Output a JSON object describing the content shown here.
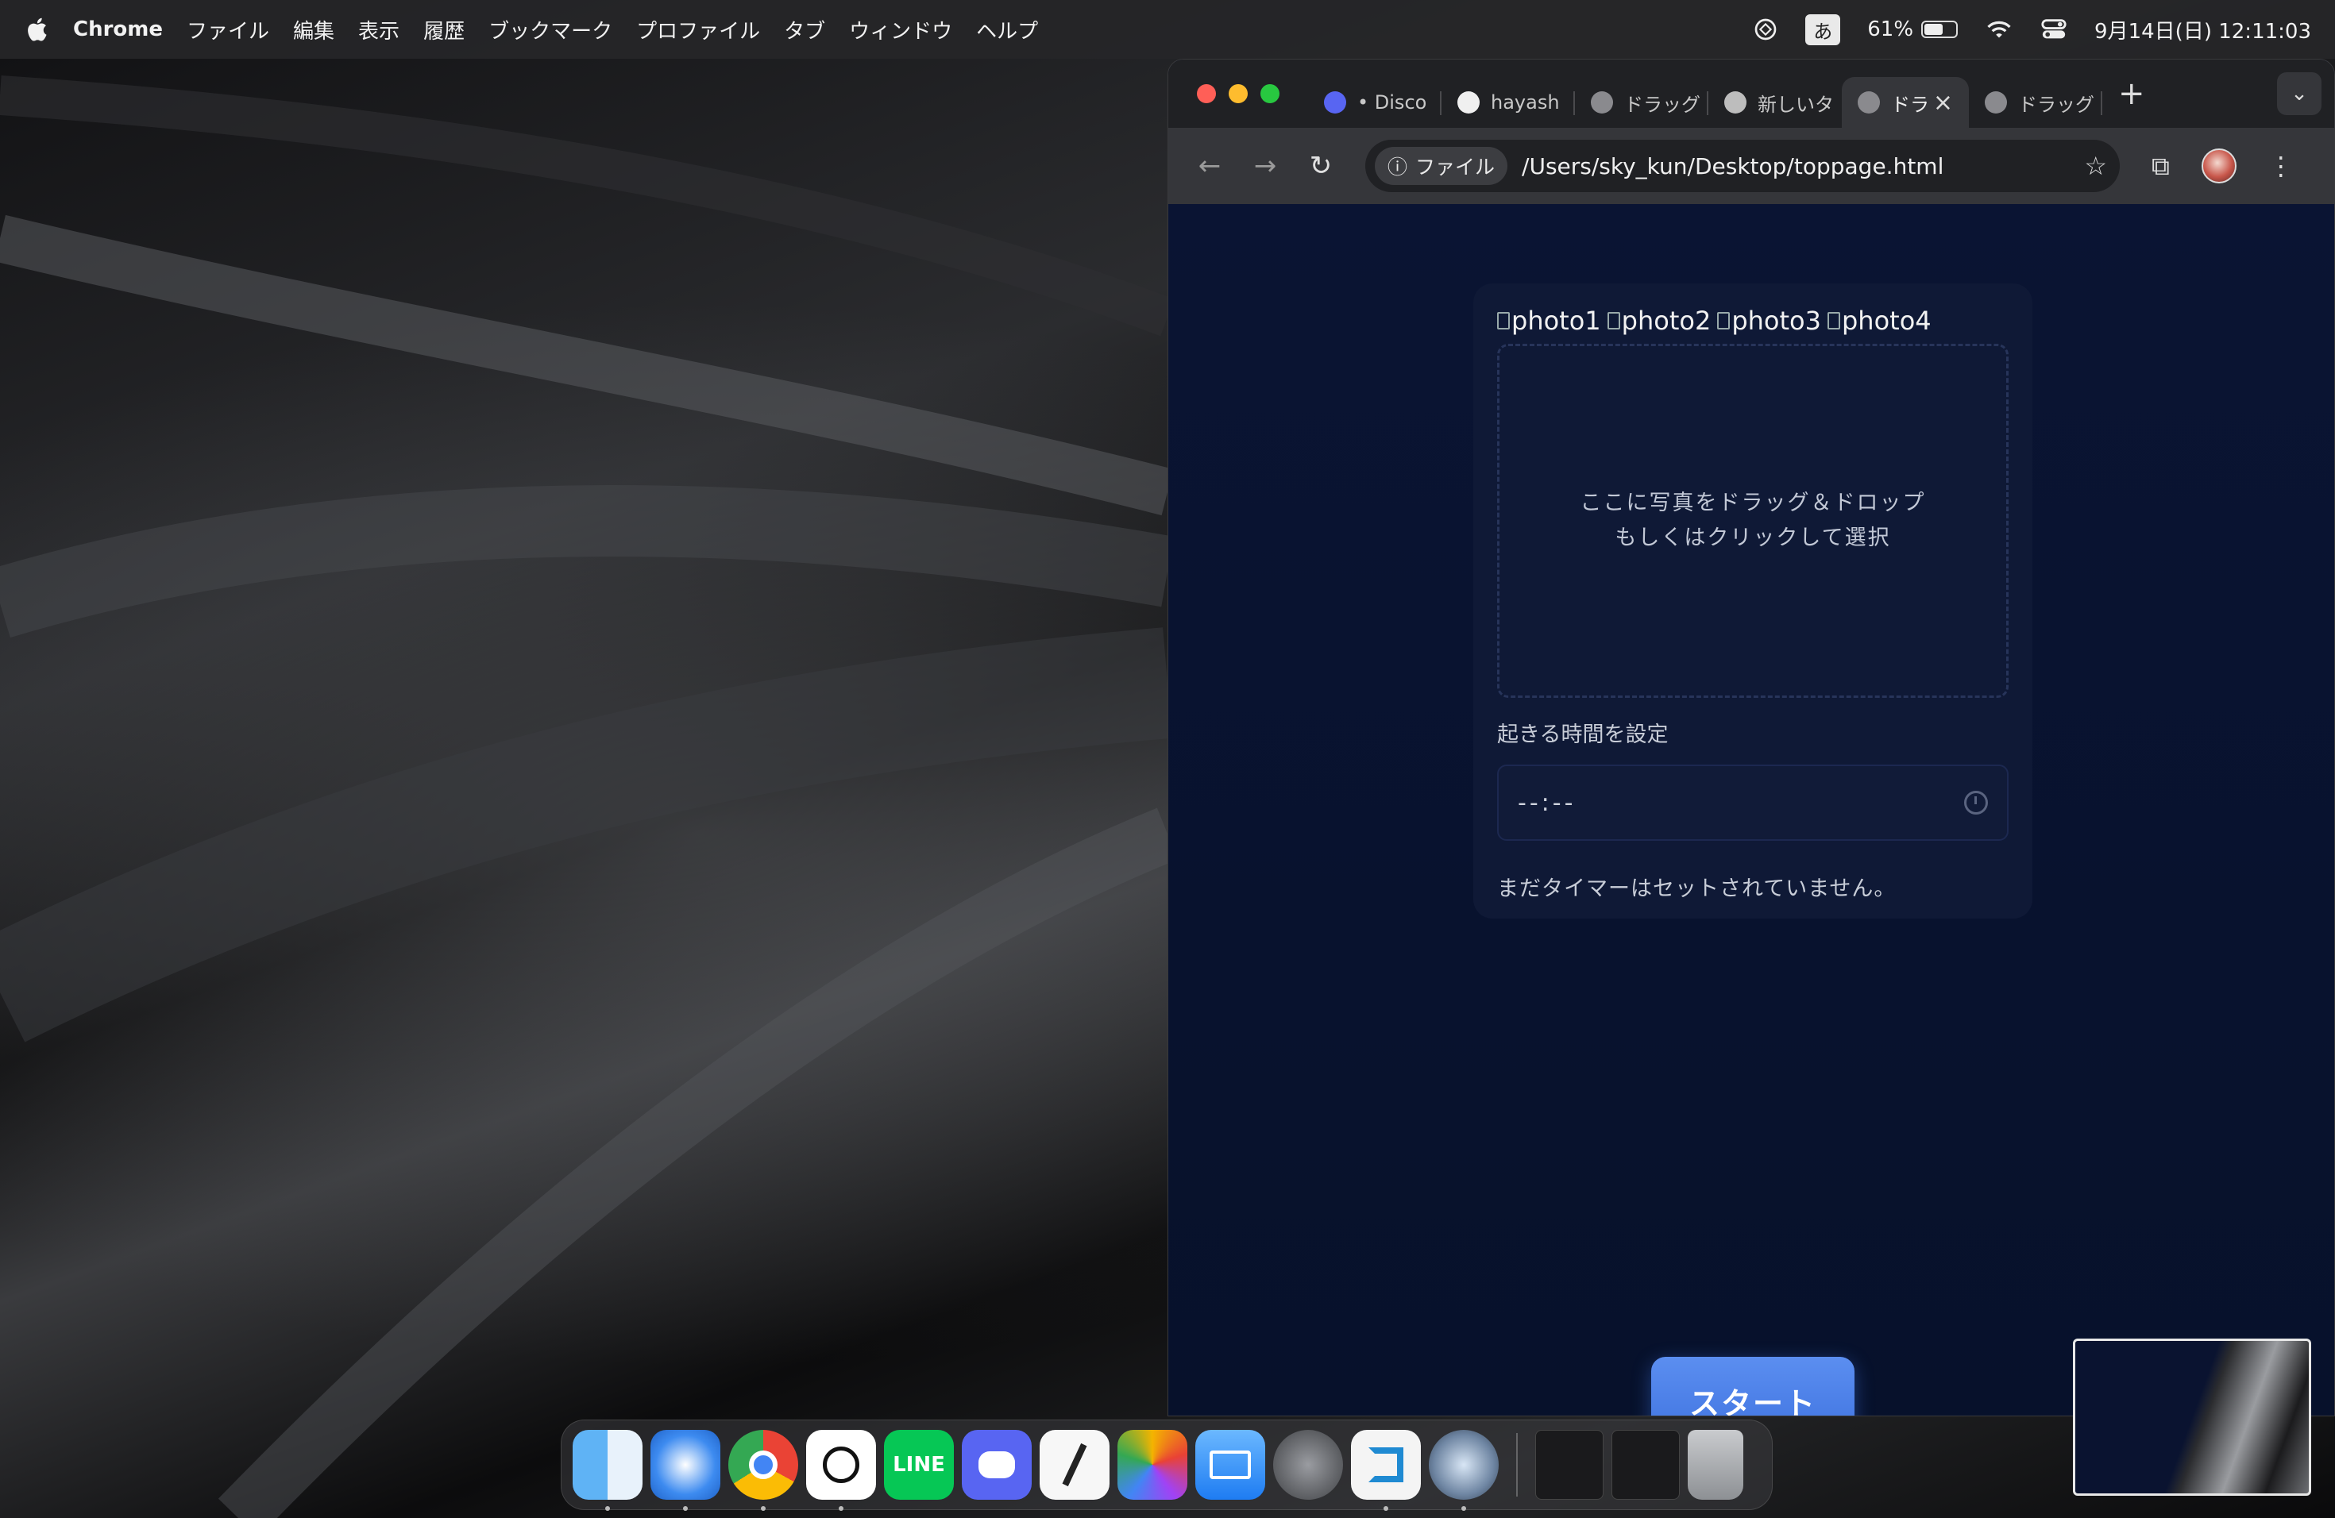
{
  "menubar": {
    "app_name": "Chrome",
    "items": [
      "ファイル",
      "編集",
      "表示",
      "履歴",
      "ブックマーク",
      "プロファイル",
      "タブ",
      "ウィンドウ",
      "ヘルプ"
    ],
    "ime": "あ",
    "battery_percent_label": "61%",
    "battery_level": 0.61,
    "datetime": "9月14日(日) 12:11:03"
  },
  "browser": {
    "tabs": [
      {
        "title": "• Disco",
        "icon": "discord-favicon"
      },
      {
        "title": "hayash",
        "icon": "github-favicon"
      },
      {
        "title": "ドラッグ",
        "icon": "globe-favicon"
      },
      {
        "title": "新しいタ",
        "icon": "chatgpt-favicon"
      },
      {
        "title": "ドラ",
        "icon": "globe-favicon",
        "active": true
      },
      {
        "title": "ドラッグ",
        "icon": "globe-favicon"
      }
    ],
    "address": {
      "chip_label": "ファイル",
      "url": "/Users/sky_kun/Desktop/toppage.html"
    }
  },
  "page": {
    "photos": [
      "photo1",
      "photo2",
      "photo3",
      "photo4"
    ],
    "dropzone": {
      "line1": "ここに写真をドラッグ＆ドロップ",
      "line2": "もしくはクリックして選択"
    },
    "time_label": "起きる時間を設定",
    "time_value": "--:--",
    "timer_status": "まだタイマーはセットされていません。",
    "start_label": "スタート"
  },
  "dock": {
    "apps": [
      "Finder",
      "Safari",
      "Google Chrome",
      "ChatGPT",
      "LINE",
      "Discord",
      "Freeform",
      "Photos",
      "Mail",
      "System Settings",
      "Visual Studio Code",
      "QuickTime Player"
    ],
    "line_label": "LINE"
  },
  "colors": {
    "accent": "#3f73e0",
    "page_bg": "#0a1433",
    "card_bg": "#0f1936"
  }
}
